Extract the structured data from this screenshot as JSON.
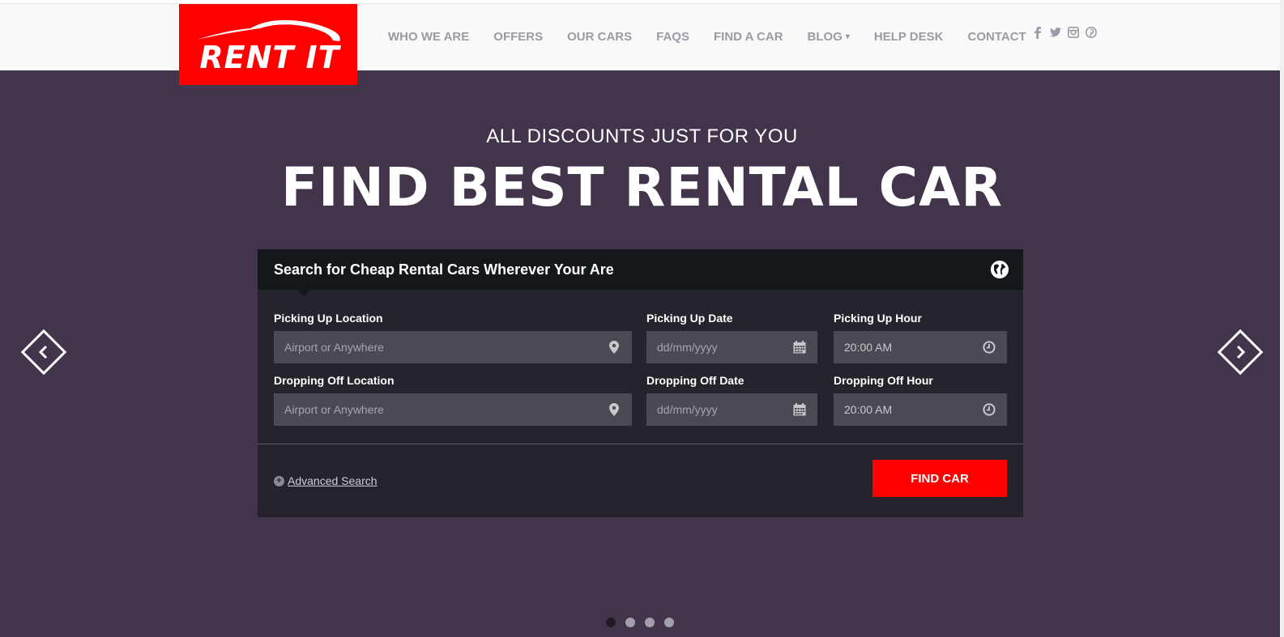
{
  "brand": {
    "name": "RENT IT",
    "logo_color": "#ff0000"
  },
  "nav": {
    "items": [
      {
        "label": "WHO WE ARE"
      },
      {
        "label": "OFFERS"
      },
      {
        "label": "OUR CARS"
      },
      {
        "label": "FAQS"
      },
      {
        "label": "FIND A CAR"
      },
      {
        "label": "BLOG",
        "has_dropdown": true
      },
      {
        "label": "HELP DESK"
      },
      {
        "label": "CONTACT"
      }
    ],
    "social_icons": [
      "facebook-icon",
      "twitter-icon",
      "instagram-icon",
      "pinterest-icon"
    ]
  },
  "hero": {
    "subtitle": "ALL DISCOUNTS JUST FOR YOU",
    "title": "FIND BEST RENTAL CAR"
  },
  "search": {
    "heading": "Search for Cheap Rental Cars Wherever Your Are",
    "pickup_location": {
      "label": "Picking Up Location",
      "placeholder": "Airport or Anywhere",
      "icon": "map-marker-icon"
    },
    "pickup_date": {
      "label": "Picking Up Date",
      "placeholder": "dd/mm/yyyy",
      "icon": "calendar-icon"
    },
    "pickup_hour": {
      "label": "Picking Up Hour",
      "value": "20:00 AM",
      "icon": "clock-icon"
    },
    "dropoff_location": {
      "label": "Dropping Off Location",
      "placeholder": "Airport or Anywhere",
      "icon": "map-marker-icon"
    },
    "dropoff_date": {
      "label": "Dropping Off Date",
      "placeholder": "dd/mm/yyyy",
      "icon": "calendar-icon"
    },
    "dropoff_hour": {
      "label": "Dropping Off Hour",
      "value": "20:00 AM",
      "icon": "clock-icon"
    },
    "advanced_label": "Advanced Search",
    "submit_label": "FIND CAR"
  },
  "slider": {
    "slide_count": 4,
    "active_slide": 1
  },
  "colors": {
    "accent": "#ff0000",
    "hero_bg": "#42344b",
    "panel_bg": "#26232d",
    "panel_header_bg": "#14171b",
    "nav_text": "#9a9ba5"
  }
}
